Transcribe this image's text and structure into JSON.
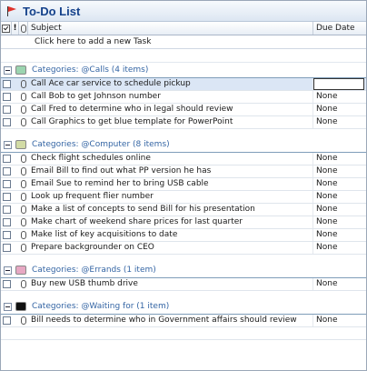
{
  "app": {
    "title": "To-Do List"
  },
  "columns": {
    "importance": "!",
    "subject": "Subject",
    "due_date": "Due Date"
  },
  "new_task": {
    "placeholder": "Click here to add a new Task"
  },
  "groups": [
    {
      "label": "Categories: @Calls (4 items)",
      "color": "#9bd4b0",
      "tasks": [
        {
          "subject": "Call Ace car service to schedule pickup",
          "due": ""
        },
        {
          "subject": "Call Bob to get Johnson number",
          "due": "None"
        },
        {
          "subject": "Call Fred to determine who in legal should review",
          "due": "None"
        },
        {
          "subject": "Call Graphics to get blue template for PowerPoint",
          "due": "None"
        }
      ]
    },
    {
      "label": "Categories: @Computer (8 items)",
      "color": "#d2dba5",
      "tasks": [
        {
          "subject": "Check flight schedules online",
          "due": "None"
        },
        {
          "subject": "Email Bill to find out what PP version he has",
          "due": "None"
        },
        {
          "subject": "Email Sue to remind her to bring USB cable",
          "due": "None"
        },
        {
          "subject": "Look up frequent flier number",
          "due": "None"
        },
        {
          "subject": "Make a list of concepts to send Bill for his presentation",
          "due": "None"
        },
        {
          "subject": "Make chart of weekend share prices for last quarter",
          "due": "None"
        },
        {
          "subject": "Make list of key acquisitions to date",
          "due": "None"
        },
        {
          "subject": "Prepare backgrounder on CEO",
          "due": "None"
        }
      ]
    },
    {
      "label": "Categories: @Errands (1 item)",
      "color": "#e7a8c3",
      "tasks": [
        {
          "subject": "Buy new USB thumb drive",
          "due": "None"
        }
      ]
    },
    {
      "label": "Categories: @Waiting for (1 item)",
      "color": "#111111",
      "tasks": [
        {
          "subject": "Bill needs to determine who in Government affairs should review",
          "due": "None"
        }
      ]
    }
  ]
}
